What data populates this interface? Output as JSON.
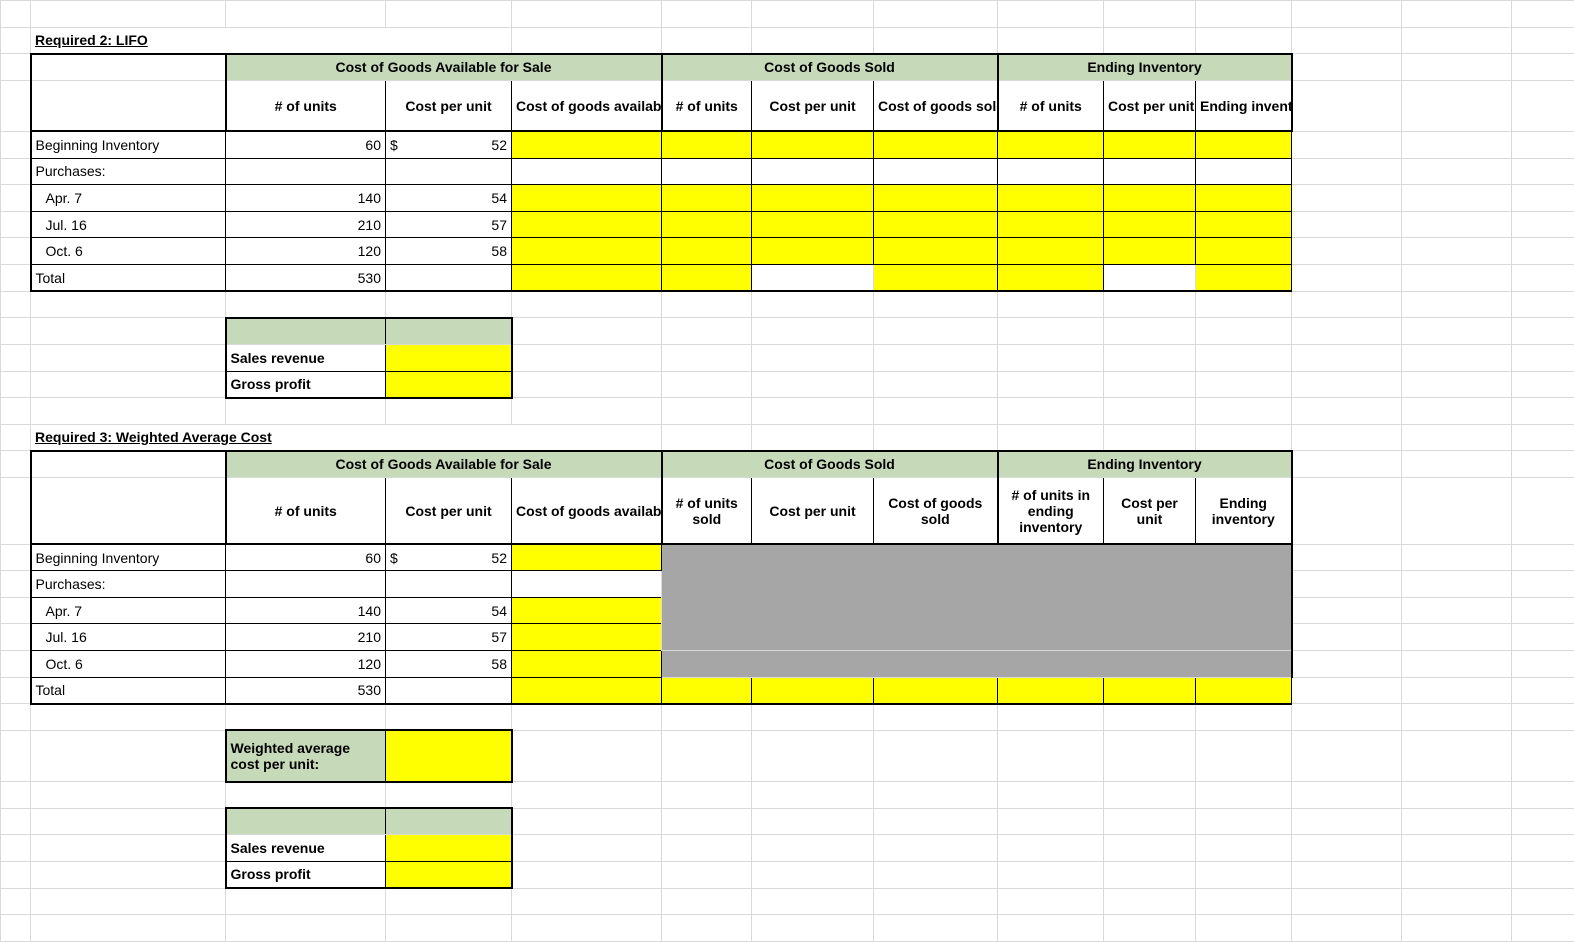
{
  "section2": {
    "title": "Required 2: LIFO",
    "group_headers": {
      "cogafs": "Cost of Goods Available for Sale",
      "cogs": "Cost of Goods Sold",
      "ei": "Ending Inventory"
    },
    "sub_headers": {
      "units": "# of units",
      "cpu": "Cost per unit",
      "cogafs_val": "Cost of goods available for sale",
      "units2": "# of units",
      "cpu2": "Cost per unit",
      "cogs_val": "Cost of goods sold",
      "units3": "# of units",
      "cpu3": "Cost per unit",
      "ei_val": "Ending inventory"
    },
    "rows": {
      "begin": {
        "label": "Beginning Inventory",
        "units": "60",
        "cpu_prefix": "$",
        "cpu": "52"
      },
      "purch_label": "Purchases:",
      "apr7": {
        "label": "Apr. 7",
        "units": "140",
        "cpu": "54"
      },
      "jul16": {
        "label": "Jul. 16",
        "units": "210",
        "cpu": "57"
      },
      "oct6": {
        "label": "Oct. 6",
        "units": "120",
        "cpu": "58"
      },
      "total": {
        "label": "Total",
        "units": "530"
      }
    },
    "rev_box": {
      "sales": "Sales revenue",
      "gp": "Gross profit"
    }
  },
  "section3": {
    "title": "Required 3: Weighted Average Cost",
    "group_headers": {
      "cogafs": "Cost of Goods Available for Sale",
      "cogs": "Cost of Goods Sold",
      "ei": "Ending Inventory"
    },
    "sub_headers": {
      "units": "# of units",
      "cpu": "Cost per unit",
      "cogafs_val": "Cost of goods available for sale",
      "units_sold": "# of units sold",
      "cpu2": "Cost per unit",
      "cogs_val": "Cost of goods sold",
      "units_ei": "# of units in ending inventory",
      "cpu3": "Cost per unit",
      "ei_val": "Ending inventory"
    },
    "rows": {
      "begin": {
        "label": "Beginning Inventory",
        "units": "60",
        "cpu_prefix": "$",
        "cpu": "52"
      },
      "purch_label": "Purchases:",
      "apr7": {
        "label": "Apr. 7",
        "units": "140",
        "cpu": "54"
      },
      "jul16": {
        "label": "Jul. 16",
        "units": "210",
        "cpu": "57"
      },
      "oct6": {
        "label": "Oct. 6",
        "units": "120",
        "cpu": "58"
      },
      "total": {
        "label": "Total",
        "units": "530"
      }
    },
    "wac_label": "Weighted average cost per unit:",
    "rev_box": {
      "sales": "Sales revenue",
      "gp": "Gross profit"
    }
  }
}
